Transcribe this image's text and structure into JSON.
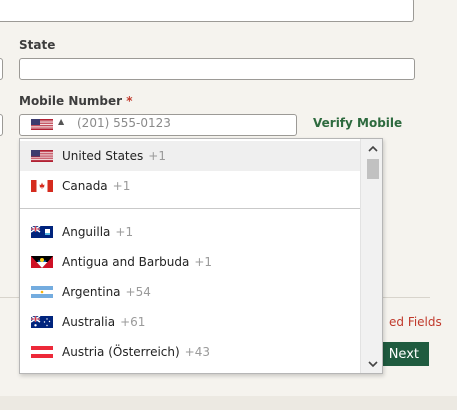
{
  "form": {
    "state_label": "State",
    "mobile_label": "Mobile Number",
    "required_star": "*",
    "phone_placeholder": "(201) 555-0123",
    "verify_link": "Verify Mobile",
    "required_note": "ed Fields",
    "next_button": "Next"
  },
  "dropdown": {
    "preferred": [
      {
        "name": "United States",
        "code": "+1",
        "flag": "us-flag-icon"
      },
      {
        "name": "Canada",
        "code": "+1",
        "flag": "canada-flag-icon"
      }
    ],
    "countries": [
      {
        "name": "Anguilla",
        "code": "+1",
        "flag": "anguilla-flag-icon"
      },
      {
        "name": "Antigua and Barbuda",
        "code": "+1",
        "flag": "antigua-flag-icon"
      },
      {
        "name": "Argentina",
        "code": "+54",
        "flag": "argentina-flag-icon"
      },
      {
        "name": "Australia",
        "code": "+61",
        "flag": "australia-flag-icon"
      },
      {
        "name": "Austria (Österreich)",
        "code": "+43",
        "flag": "austria-flag-icon"
      }
    ]
  },
  "colors": {
    "accent_green": "#2d6a3e",
    "button_green": "#1f5b3f",
    "required_red": "#c0392b"
  }
}
